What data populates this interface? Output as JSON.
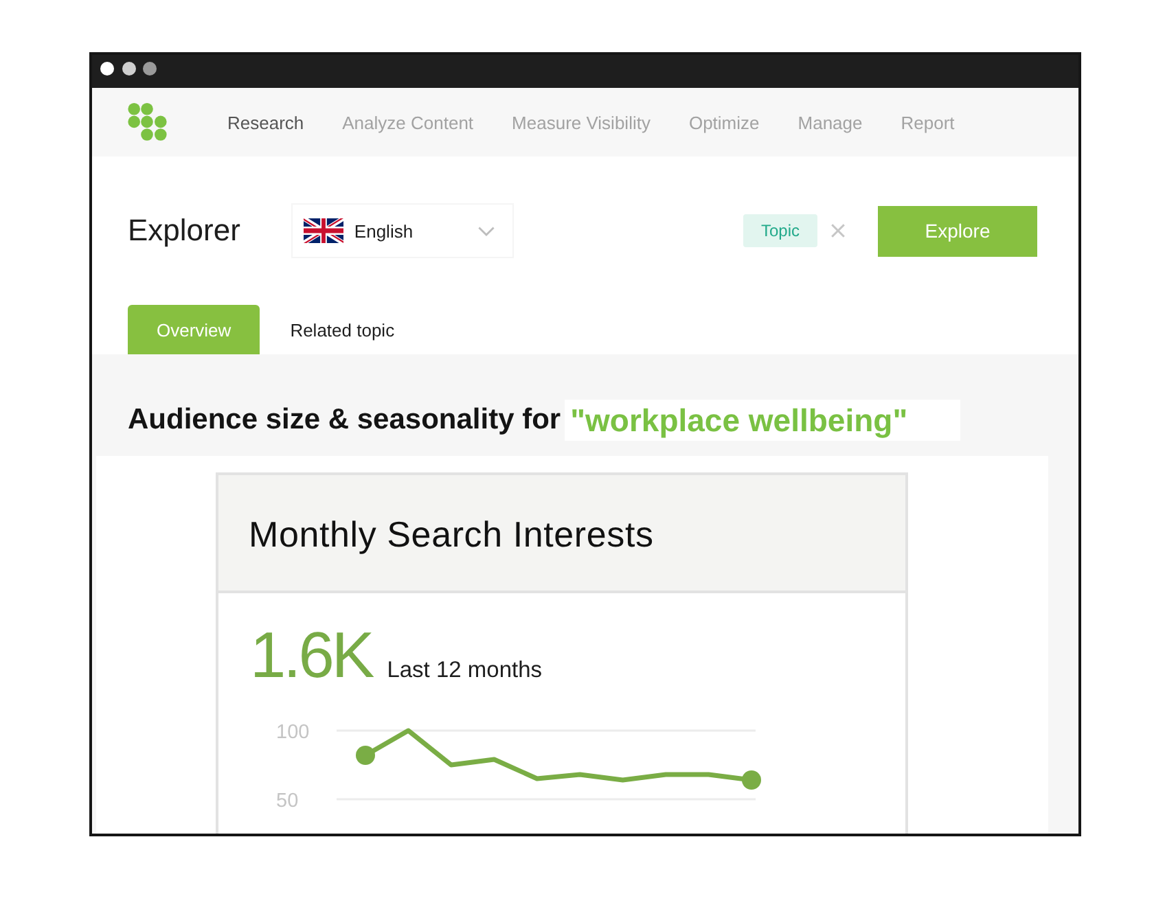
{
  "nav": {
    "items": [
      {
        "label": "Research",
        "selected": true
      },
      {
        "label": "Analyze Content",
        "selected": false
      },
      {
        "label": "Measure Visibility",
        "selected": false
      },
      {
        "label": "Optimize",
        "selected": false
      },
      {
        "label": "Manage",
        "selected": false
      },
      {
        "label": "Report",
        "selected": false
      }
    ]
  },
  "toolbar": {
    "title": "Explorer",
    "language": "English",
    "tag": "Topic",
    "action": "Explore"
  },
  "tabs": [
    {
      "label": "Overview",
      "selected": true
    },
    {
      "label": "Related topic",
      "selected": false
    }
  ],
  "section": {
    "heading": "Audience size & seasonality for",
    "keyword": "\"workplace wellbeing\""
  },
  "card": {
    "title": "Monthly Search Interests",
    "metric": "1.6K",
    "period": "Last 12 months",
    "chart_data": {
      "type": "line",
      "ylim": [
        50,
        100
      ],
      "yticks": [
        50,
        100
      ],
      "series": [
        {
          "color": "#7aad45",
          "values": [
            82,
            100,
            75,
            79,
            65,
            68,
            64,
            68,
            68,
            64
          ]
        }
      ]
    }
  }
}
